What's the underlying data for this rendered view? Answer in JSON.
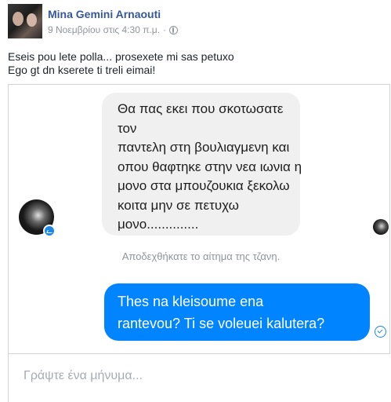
{
  "post": {
    "author": "Mina Gemini Arnaouti",
    "timestamp": "9 Νοεμβρίου στις 4:30 π.μ.",
    "separator": "·",
    "privacy_icon": "globe-icon",
    "text_line1": "Eseis pou lete polla... prosexete mi sas petuxo",
    "text_line2": "Ego gt dn kserete ti treli eimai!"
  },
  "chat": {
    "incoming_message": "Θα πας εκει που σκοτωσατε τον\nπαντελη στη βουλιαγμενη και\nοπου θαφτηκε στην νεα ιωνια η\nμονο στα μπουζουκια ξεκολω\nκοιτα μην σε πετυχω\nμονο..............",
    "system_note": "Αποδεχθήκατε το αίτημα της τζανη.",
    "outgoing_message": "Thes na kleisoume ena\nrantevou? Ti se voleuei kalutera?",
    "composer_placeholder": "Γράψτε ένα μήνυμα...",
    "badge_icon": "messenger-icon",
    "sent_icon": "check-circle-icon"
  },
  "colors": {
    "author": "#365899",
    "incoming_bubble": "#f1f0f0",
    "outgoing_bubble": "#0084ff",
    "meta_text": "#90949c"
  }
}
